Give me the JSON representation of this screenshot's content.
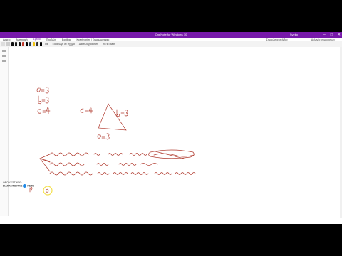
{
  "window": {
    "title": "OneNote for Windows 10",
    "account": "Sveko",
    "controls": [
      "–",
      "□",
      "✕"
    ]
  },
  "menu": {
    "items": [
      "Αρχείο",
      "Αντιγραφή",
      "Σχέδιο",
      "Προβολή",
      "Βοήθεια",
      "Κοινή χρήση / Σημειωματάριο"
    ],
    "active_index": 2,
    "right_items": [
      "Σημειώσεις σελίδας",
      "Αλλαγές σημειώσεων"
    ]
  },
  "toolbar": {
    "pen_colors": [
      "#111111",
      "#1a1a1a",
      "#111111",
      "#c0392b",
      "#000000",
      "#2c3e50",
      "#f1c40f",
      "#333333",
      "#000000"
    ],
    "labels": [
      "Ink",
      "Εισαγωγή σε σχήμα",
      "Δακτυλογράφηση",
      "Ink to Math"
    ]
  },
  "brand": {
    "line1": "ΦΡΟΝΤΙΣΤΗΡΙΟ",
    "line2": "ΣΙΑΜΑΝΤΟΥΡΑΣ",
    "suffix": "NETN"
  },
  "ink": {
    "color": "#b03a2e",
    "highlight": "#f4e04d"
  }
}
